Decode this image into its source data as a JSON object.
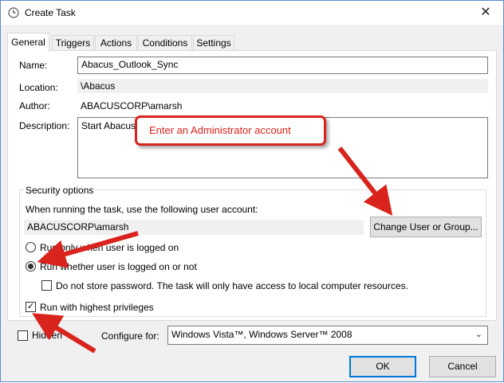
{
  "window": {
    "title": "Create Task",
    "close_glyph": "✕"
  },
  "tabs": [
    {
      "label": "General",
      "active": true
    },
    {
      "label": "Triggers"
    },
    {
      "label": "Actions"
    },
    {
      "label": "Conditions"
    },
    {
      "label": "Settings"
    }
  ],
  "general": {
    "name_label": "Name:",
    "name_value": "Abacus_Outlook_Sync",
    "location_label": "Location:",
    "location_value": "\\Abacus",
    "author_label": "Author:",
    "author_value": "ABACUSCORP\\amarsh",
    "description_label": "Description:",
    "description_value": "Start Abacus"
  },
  "security": {
    "group_label": "Security options",
    "account_prompt": "When running the task, use the following user account:",
    "account_value": "ABACUSCORP\\amarsh",
    "change_button": "Change User or Group...",
    "radio_logged_on_label": "Run only when user is logged on",
    "radio_whether_label": "Run whether user is logged on or not",
    "selected_radio": "whether",
    "do_not_store_label": "Do not store password.  The task will only have access to local computer resources.",
    "do_not_store_checked": false,
    "highest_privileges_label": "Run with highest privileges",
    "highest_privileges_checked": true
  },
  "footer": {
    "hidden_label": "Hidden",
    "hidden_checked": false,
    "configure_label": "Configure for:",
    "configure_value": "Windows Vista™, Windows Server™ 2008",
    "ok_button": "OK",
    "cancel_button": "Cancel"
  },
  "annotation": {
    "callout_text": "Enter an Administrator account",
    "accent_color": "#d9231d"
  },
  "icons": {
    "app": "clock-icon",
    "check": "✓",
    "dropdown": "⌄"
  }
}
